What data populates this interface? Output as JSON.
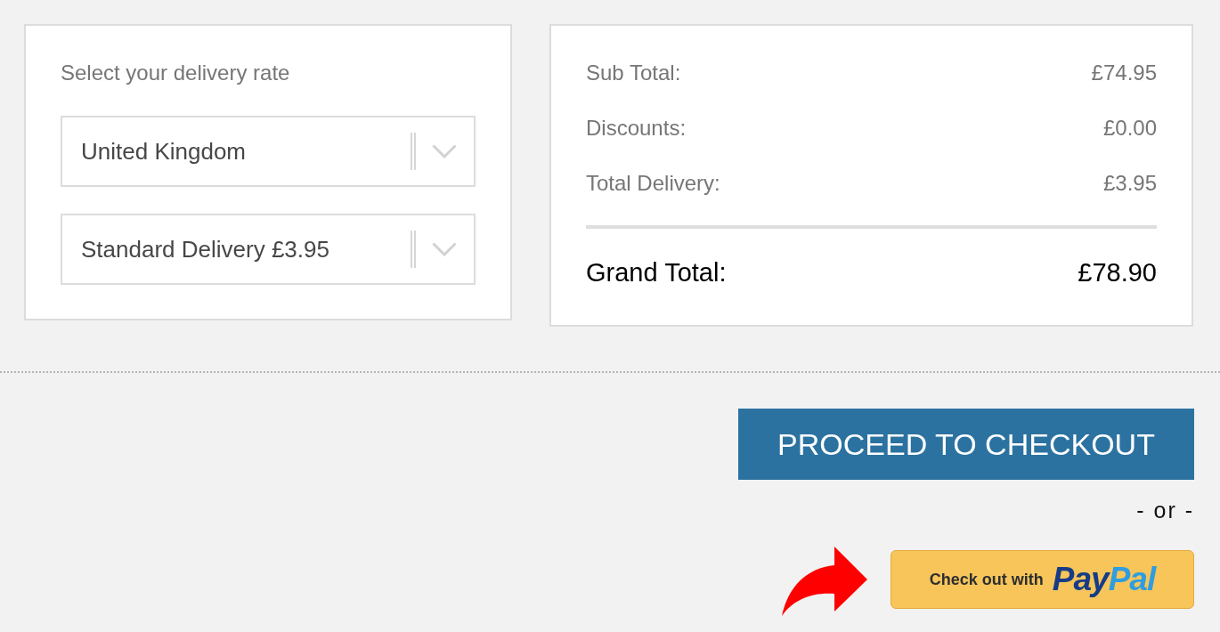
{
  "delivery": {
    "title": "Select your delivery rate",
    "selects": [
      {
        "kind": "dropdown",
        "value": "United Kingdom"
      },
      {
        "kind": "dropdown",
        "value": "Standard Delivery £3.95"
      }
    ]
  },
  "summary": {
    "rows": [
      {
        "label": "Sub Total:",
        "value": "£74.95"
      },
      {
        "label": "Discounts:",
        "value": "£0.00"
      },
      {
        "label": "Total Delivery:",
        "value": "£3.95"
      }
    ],
    "grand_total": {
      "label": "Grand Total:",
      "value": "£78.90"
    }
  },
  "checkout_button": "PROCEED TO CHECKOUT",
  "separator": "- or -",
  "paypal_button": {
    "text": "Check out with",
    "logo": [
      {
        "text": "Pay",
        "color": "#163c87"
      },
      {
        "text": "Pal",
        "color": "#2f9ddf"
      }
    ]
  }
}
